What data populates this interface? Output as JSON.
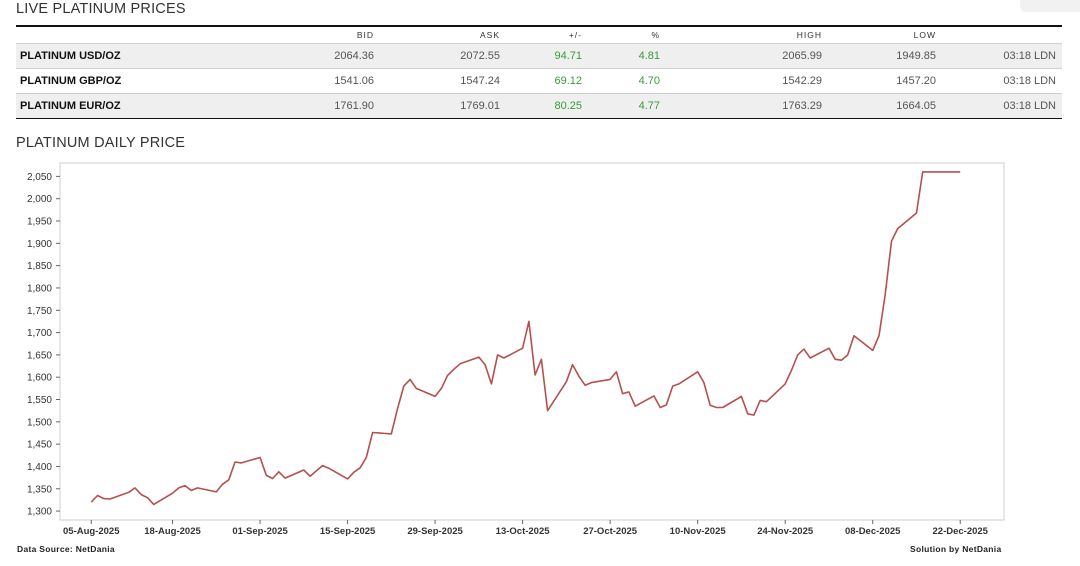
{
  "live": {
    "title": "LIVE PLATINUM PRICES",
    "headers": [
      "",
      "BID",
      "ASK",
      "+/-",
      "%",
      "HIGH",
      "LOW",
      ""
    ],
    "rows": [
      {
        "name": "PLATINUM USD/OZ",
        "bid": "2064.36",
        "ask": "2072.55",
        "chg": "94.71",
        "pct": "4.81",
        "high": "2065.99",
        "low": "1949.85",
        "time": "03:18 LDN"
      },
      {
        "name": "PLATINUM GBP/OZ",
        "bid": "1541.06",
        "ask": "1547.24",
        "chg": "69.12",
        "pct": "4.70",
        "high": "1542.29",
        "low": "1457.20",
        "time": "03:18 LDN"
      },
      {
        "name": "PLATINUM EUR/OZ",
        "bid": "1761.90",
        "ask": "1769.01",
        "chg": "80.25",
        "pct": "4.77",
        "high": "1763.29",
        "low": "1664.05",
        "time": "03:18 LDN"
      }
    ],
    "change_color": "#3a9a3a"
  },
  "daily": {
    "title": "PLATINUM DAILY PRICE",
    "data_source": "Data Source: NetDania",
    "solution": "Solution by NetDania"
  },
  "chart_data": {
    "type": "line",
    "title": "",
    "xlabel": "",
    "ylabel": "",
    "ylim": [
      1280,
      2080
    ],
    "yticks": [
      1300,
      1350,
      1400,
      1450,
      1500,
      1550,
      1600,
      1650,
      1700,
      1750,
      1800,
      1850,
      1900,
      1950,
      2000,
      2050
    ],
    "xlim": [
      "2025-07-31",
      "2025-12-29"
    ],
    "xtick_labels": [
      "05-Aug-2025",
      "18-Aug-2025",
      "01-Sep-2025",
      "15-Sep-2025",
      "29-Sep-2025",
      "13-Oct-2025",
      "27-Oct-2025",
      "10-Nov-2025",
      "24-Nov-2025",
      "08-Dec-2025",
      "22-Dec-2025"
    ],
    "line_color": "#b5504d",
    "grid": false,
    "series": [
      {
        "x": [
          "2025-08-05",
          "2025-08-06",
          "2025-08-07",
          "2025-08-08",
          "2025-08-11",
          "2025-08-12",
          "2025-08-13",
          "2025-08-14",
          "2025-08-15",
          "2025-08-18",
          "2025-08-19",
          "2025-08-20",
          "2025-08-21",
          "2025-08-22",
          "2025-08-25",
          "2025-08-26",
          "2025-08-27",
          "2025-08-28",
          "2025-08-29",
          "2025-09-01",
          "2025-09-02",
          "2025-09-03",
          "2025-09-04",
          "2025-09-05",
          "2025-09-08",
          "2025-09-09",
          "2025-09-10",
          "2025-09-11",
          "2025-09-12",
          "2025-09-15",
          "2025-09-16",
          "2025-09-17",
          "2025-09-18",
          "2025-09-19",
          "2025-09-22",
          "2025-09-23",
          "2025-09-24",
          "2025-09-25",
          "2025-09-26",
          "2025-09-29",
          "2025-09-30",
          "2025-10-01",
          "2025-10-02",
          "2025-10-03",
          "2025-10-06",
          "2025-10-07",
          "2025-10-08",
          "2025-10-09",
          "2025-10-10",
          "2025-10-13",
          "2025-10-14",
          "2025-10-15",
          "2025-10-16",
          "2025-10-17",
          "2025-10-20",
          "2025-10-21",
          "2025-10-22",
          "2025-10-23",
          "2025-10-24",
          "2025-10-27",
          "2025-10-28",
          "2025-10-29",
          "2025-10-30",
          "2025-10-31",
          "2025-11-03",
          "2025-11-04",
          "2025-11-05",
          "2025-11-06",
          "2025-11-07",
          "2025-11-10",
          "2025-11-11",
          "2025-11-12",
          "2025-11-13",
          "2025-11-14",
          "2025-11-17",
          "2025-11-18",
          "2025-11-19",
          "2025-11-20",
          "2025-11-21",
          "2025-11-24",
          "2025-11-25",
          "2025-11-26",
          "2025-11-27",
          "2025-11-28",
          "2025-12-01",
          "2025-12-02",
          "2025-12-03",
          "2025-12-04",
          "2025-12-05",
          "2025-12-08",
          "2025-12-09",
          "2025-12-10",
          "2025-12-11",
          "2025-12-12",
          "2025-12-15",
          "2025-12-16",
          "2025-12-17",
          "2025-12-18",
          "2025-12-19",
          "2025-12-22"
        ],
        "y": [
          1320,
          1335,
          1328,
          1327,
          1342,
          1352,
          1337,
          1330,
          1315,
          1340,
          1352,
          1357,
          1346,
          1352,
          1343,
          1360,
          1370,
          1410,
          1408,
          1420,
          1380,
          1373,
          1388,
          1374,
          1392,
          1378,
          1390,
          1402,
          1396,
          1372,
          1387,
          1397,
          1420,
          1476,
          1473,
          1530,
          1580,
          1595,
          1575,
          1557,
          1575,
          1604,
          1618,
          1630,
          1645,
          1628,
          1585,
          1650,
          1643,
          1665,
          1725,
          1605,
          1640,
          1525,
          1590,
          1628,
          1602,
          1582,
          1588,
          1595,
          1612,
          1563,
          1567,
          1535,
          1558,
          1532,
          1538,
          1580,
          1585,
          1612,
          1588,
          1537,
          1532,
          1532,
          1557,
          1518,
          1515,
          1548,
          1545,
          1585,
          1615,
          1650,
          1663,
          1643,
          1665,
          1640,
          1638,
          1650,
          1693,
          1660,
          1693,
          1785,
          1905,
          1933,
          1968,
          2060,
          2060,
          2060,
          2060,
          2060
        ]
      }
    ]
  }
}
